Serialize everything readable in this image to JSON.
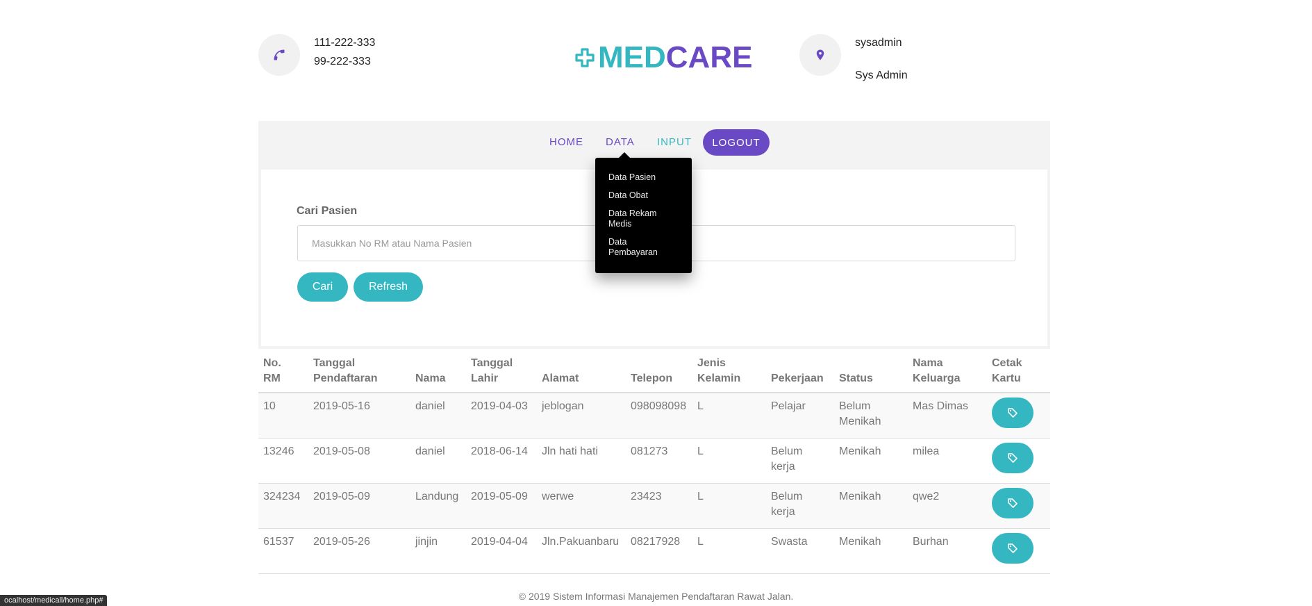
{
  "header": {
    "phones": [
      "111-222-333",
      "99-222-333"
    ],
    "logo_part1": "MEDCARE",
    "logo_med": "MED",
    "logo_care": "CARE",
    "user": {
      "username": "sysadmin",
      "role": "Sys Admin"
    },
    "icons": {
      "phone": "phone-icon",
      "location": "map-pin-icon",
      "logo": "plus-cross-icon"
    },
    "colors": {
      "teal": "#35b7c1",
      "purple": "#6a4ac4"
    }
  },
  "nav": {
    "home": "HOME",
    "data": "DATA",
    "input": "INPUT",
    "logout": "LOGOUT"
  },
  "dropdown": {
    "items": [
      "Data Pasien",
      "Data Obat",
      "Data Rekam Medis",
      "Data Pembayaran"
    ]
  },
  "search": {
    "label": "Cari Pasien",
    "placeholder": "Masukkan No RM atau Nama Pasien",
    "cari": "Cari",
    "refresh": "Refresh"
  },
  "table": {
    "headers": [
      "No. RM",
      "Tanggal Pendaftaran",
      "Nama",
      "Tanggal Lahir",
      "Alamat",
      "Telepon",
      "Jenis Kelamin",
      "Pekerjaan",
      "Status",
      "Nama Keluarga",
      "Cetak Kartu"
    ],
    "rows": [
      [
        "10",
        "2019-05-16",
        "daniel",
        "2019-04-03",
        "jeblogan",
        "098098098",
        "L",
        "Pelajar",
        "Belum Menikah",
        "Mas Dimas"
      ],
      [
        "13246",
        "2019-05-08",
        "daniel",
        "2018-06-14",
        "Jln hati hati",
        "081273",
        "L",
        "Belum kerja",
        "Menikah",
        "milea"
      ],
      [
        "324234",
        "2019-05-09",
        "Landung",
        "2019-05-09",
        "werwe",
        "23423",
        "L",
        "Belum kerja",
        "Menikah",
        "qwe2"
      ],
      [
        "61537",
        "2019-05-26",
        "jinjin",
        "2019-04-04",
        "Jln.Pakuanbaru",
        "08217928",
        "L",
        "Swasta",
        "Menikah",
        "Burhan"
      ]
    ],
    "print_icon": "tag-icon"
  },
  "footer": "© 2019 Sistem Informasi Manajemen Pendaftaran Rawat Jalan.",
  "status_url": "ocalhost/medicall/home.php#"
}
